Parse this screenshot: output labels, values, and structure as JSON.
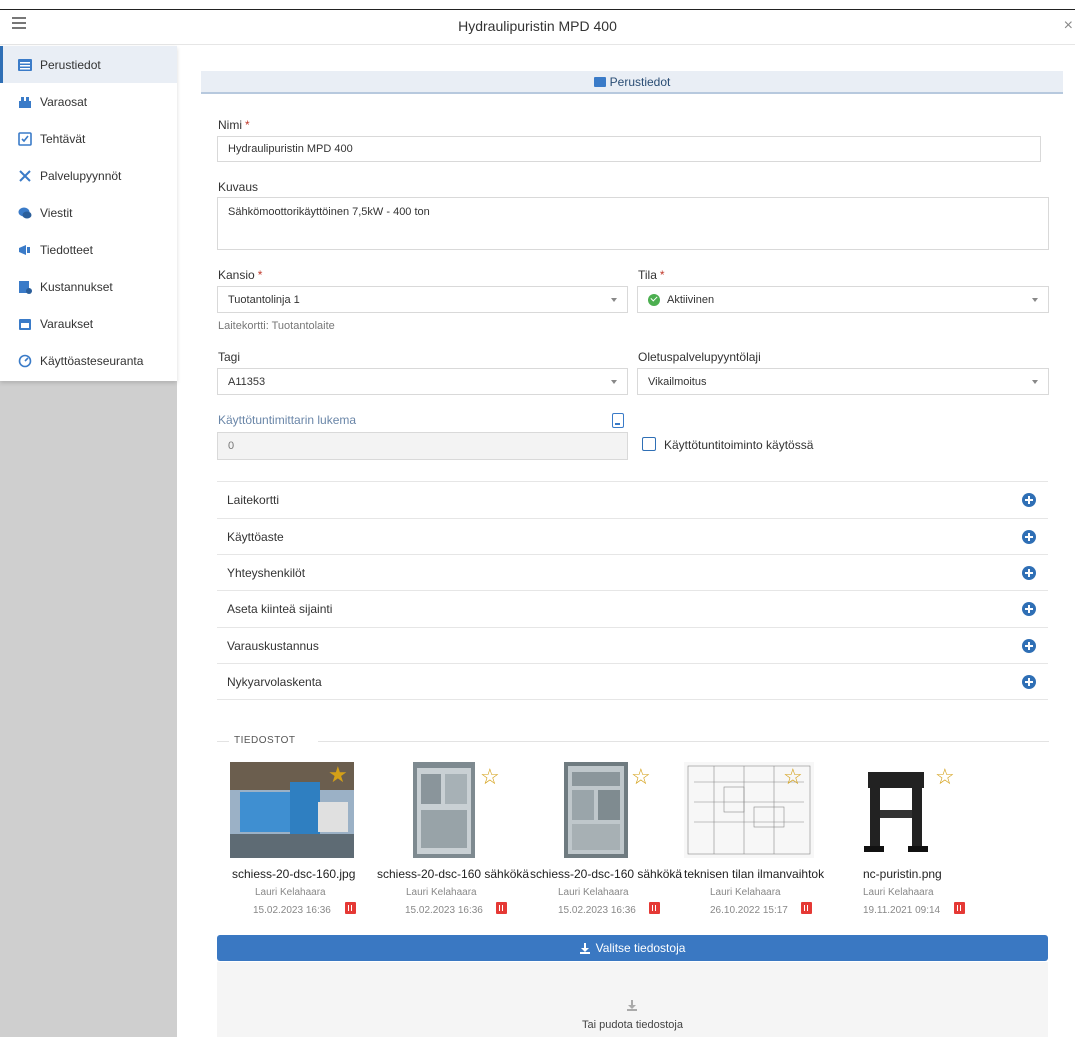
{
  "window": {
    "title": "Hydraulipuristin MPD 400",
    "close": "×"
  },
  "sidebar": {
    "items": [
      {
        "label": "Perustiedot",
        "icon": "list-icon"
      },
      {
        "label": "Varaosat",
        "icon": "parts-icon"
      },
      {
        "label": "Tehtävät",
        "icon": "task-icon"
      },
      {
        "label": "Palvelupyynnöt",
        "icon": "tools-icon"
      },
      {
        "label": "Viestit",
        "icon": "chat-icon"
      },
      {
        "label": "Tiedotteet",
        "icon": "megaphone-icon"
      },
      {
        "label": "Kustannukset",
        "icon": "cost-icon"
      },
      {
        "label": "Varaukset",
        "icon": "calendar-icon"
      },
      {
        "label": "Käyttöasteseuranta",
        "icon": "gauge-icon"
      }
    ]
  },
  "section": {
    "title": "Perustiedot"
  },
  "form": {
    "name_label": "Nimi",
    "name_value": "Hydraulipuristin MPD 400",
    "desc_label": "Kuvaus",
    "desc_value": "Sähkömoottorikäyttöinen 7,5kW - 400 ton",
    "folder_label": "Kansio",
    "folder_value": "Tuotantolinja 1",
    "folder_hint": "Laitekortti: Tuotantolaite",
    "status_label": "Tila",
    "status_value": "Aktiivinen",
    "tag_label": "Tagi",
    "tag_value": "A11353",
    "service_label": "Oletuspalvelupyyntölaji",
    "service_value": "Vikailmoitus",
    "meter_label": "Käyttötuntimittarin lukema",
    "meter_value": "0",
    "meter_checkbox_label": "Käyttötuntitoiminto käytössä",
    "required_mark": "*"
  },
  "accordion": [
    "Laitekortti",
    "Käyttöaste",
    "Yhteyshenkilöt",
    "Aseta kiinteä sijainti",
    "Varauskustannus",
    "Nykyarvolaskenta"
  ],
  "files": {
    "title": "TIEDOSTOT",
    "items": [
      {
        "name": "schiess-20-dsc-160.jpg",
        "user": "Lauri Kelahaara",
        "date": "15.02.2023 16:36",
        "starred": true
      },
      {
        "name": "schiess-20-dsc-160 sähkökä",
        "user": "Lauri Kelahaara",
        "date": "15.02.2023 16:36",
        "starred": false
      },
      {
        "name": "schiess-20-dsc-160 sähkökä",
        "user": "Lauri Kelahaara",
        "date": "15.02.2023 16:36",
        "starred": false
      },
      {
        "name": "teknisen tilan ilmanvaihtok",
        "user": "Lauri Kelahaara",
        "date": "26.10.2022 15:17",
        "starred": false
      },
      {
        "name": "nc-puristin.png",
        "user": "Lauri Kelahaara",
        "date": "19.11.2021 09:14",
        "starred": false
      }
    ],
    "upload_label": "Valitse tiedostoja",
    "drop_label": "Tai pudota tiedostoja"
  },
  "colors": {
    "accent": "#3a78c2",
    "active_bg": "#e9eef5",
    "status_green": "#4caf50",
    "trash_red": "#e53935",
    "star_gold": "#d4a017"
  }
}
